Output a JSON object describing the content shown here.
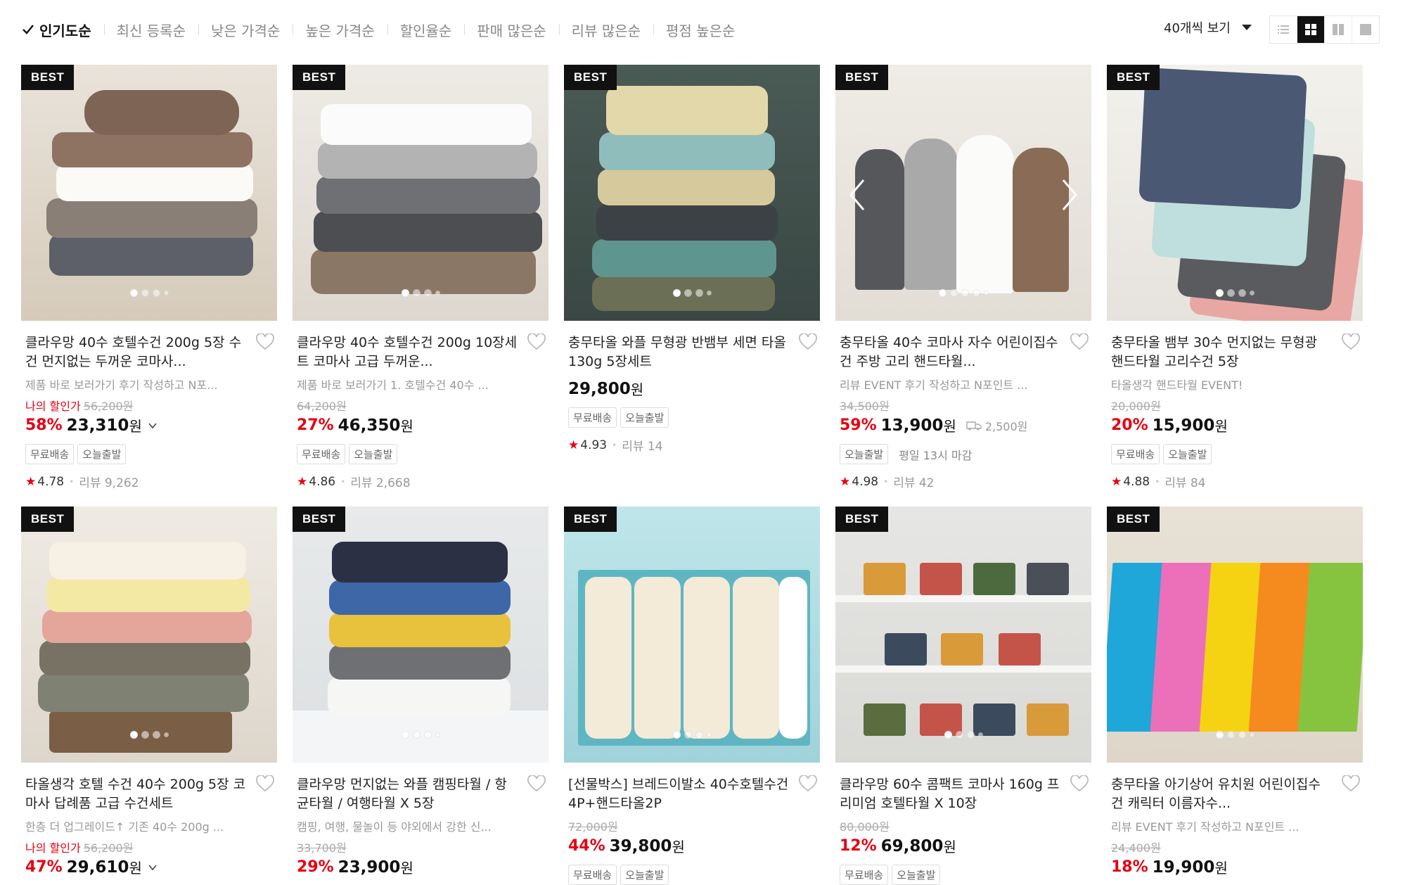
{
  "sort": {
    "items": [
      "인기도순",
      "최신 등록순",
      "낮은 가격순",
      "높은 가격순",
      "할인율순",
      "판매 많은순",
      "리뷰 많은순",
      "평점 높은순"
    ],
    "active_index": 0,
    "per_page": "40개씩 보기"
  },
  "view_modes": [
    "list-view-icon",
    "grid-4-view-icon",
    "grid-2-view-icon",
    "single-view-icon"
  ],
  "badge_label": "BEST",
  "icons": {
    "heart": "heart-icon",
    "star": "★",
    "check": "check-icon"
  },
  "colors": {
    "discount": "#e60012",
    "badge_bg": "#111111"
  },
  "products": [
    {
      "title": "클라우망 40수 호텔수건 200g 5장 수건 먼지없는 두꺼운 코마사...",
      "desc": "제품 바로 보러가기 후기 작성하고 N포...",
      "my_price_label": "나의 할인가",
      "original_price": "56,200원",
      "discount": "58%",
      "price": "23,310",
      "won": "원",
      "tags": [
        "무료배송",
        "오늘출발"
      ],
      "rating": "4.78",
      "reviews": "리뷰 9,262",
      "dots": 4
    },
    {
      "title": "클라우망 40수 호텔수건 200g 10장세트 코마사 고급 두꺼운...",
      "desc": "제품 바로 보러가기 1. 호텔수건 40수 ...",
      "original_price": "64,200원",
      "discount": "27%",
      "price": "46,350",
      "won": "원",
      "tags": [
        "무료배송",
        "오늘출발"
      ],
      "rating": "4.86",
      "reviews": "리뷰 2,668",
      "dots": 4
    },
    {
      "title": "충무타올 와플 무형광 반뱀부 세면 타올 130g 5장세트",
      "price": "29,800",
      "won": "원",
      "tags": [
        "무료배송",
        "오늘출발"
      ],
      "rating": "4.93",
      "reviews": "리뷰 14",
      "dots": 4
    },
    {
      "title": "충무타올 40수 코마사 자수 어린이집수건 주방 고리 핸드타월...",
      "desc": "리뷰 EVENT 후기 작성하고 N포인트 ...",
      "original_price": "34,500원",
      "discount": "59%",
      "price": "13,900",
      "won": "원",
      "shipping_fee": "2,500원",
      "tags": [
        "오늘출발"
      ],
      "deadline": "평일 13시 마감",
      "rating": "4.98",
      "reviews": "리뷰 42",
      "dots": 5
    },
    {
      "title": "충무타올 뱀부 30수 먼지없는 무형광 핸드타월 고리수건 5장",
      "desc": "타올생각 핸드타월 EVENT!",
      "original_price": "20,000원",
      "discount": "20%",
      "price": "15,900",
      "won": "원",
      "tags": [
        "무료배송",
        "오늘출발"
      ],
      "rating": "4.88",
      "reviews": "리뷰 84",
      "dots": 4
    },
    {
      "title": "타올생각 호텔 수건 40수 200g 5장 코마사 답례품 고급 수건세트",
      "desc": "한층 더 업그레이드↑ 기존 40수 200g ...",
      "my_price_label": "나의 할인가",
      "original_price": "56,200원",
      "discount": "47%",
      "price": "29,610",
      "won": "원",
      "dots": 4
    },
    {
      "title": "클라우망 먼지없는 와플 캠핑타월 / 항균타월 / 여행타월 X 5장",
      "desc": "캠핑, 여행, 물놀이 등 야외에서 강한 신...",
      "original_price": "33,700원",
      "discount": "29%",
      "price": "23,900",
      "won": "원",
      "dots": 4
    },
    {
      "title": "[선물박스] 브레드이발소 40수호텔수건4P+핸드타올2P",
      "original_price": "72,000원",
      "discount": "44%",
      "price": "39,800",
      "won": "원",
      "tags": [
        "무료배송",
        "오늘출발"
      ],
      "dots": 4
    },
    {
      "title": "클라우망 60수 콤팩트 코마사 160g 프리미엄 호텔타월 X 10장",
      "original_price": "80,000원",
      "discount": "12%",
      "price": "69,800",
      "won": "원",
      "tags": [
        "무료배송",
        "오늘출발"
      ],
      "dots": 4
    },
    {
      "title": "충무타올 아기상어 유치원 어린이집수건 캐릭터 이름자수...",
      "desc": "리뷰 EVENT 후기 작성하고 N포인트 ...",
      "original_price": "24,400원",
      "discount": "18%",
      "price": "19,900",
      "won": "원",
      "dots": 4
    }
  ]
}
